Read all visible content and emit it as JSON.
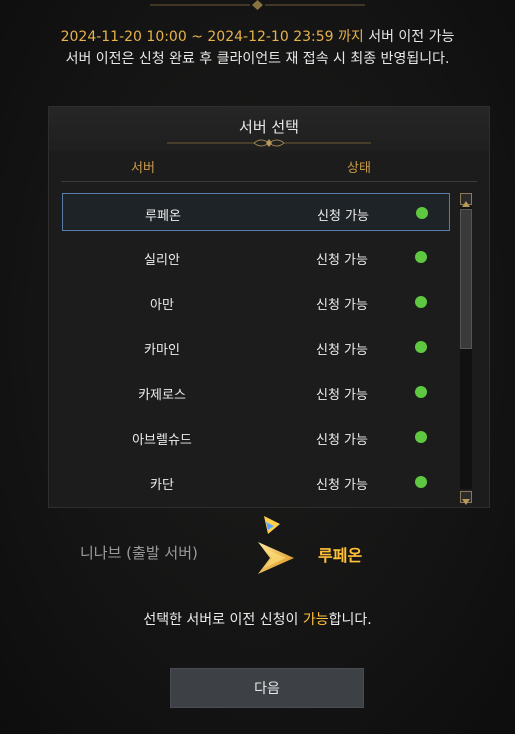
{
  "notice": {
    "period": "2024-11-20 10:00 ~ 2024-12-10 23:59 까지",
    "period_suffix": " 서버 이전 가능",
    "line2": "서버 이전은 신청 완료 후 클라이언트 재 접속 시 최종 반영됩니다."
  },
  "panel": {
    "title": "서버 선택",
    "col_server": "서버",
    "col_status": "상태",
    "rows": [
      {
        "name": "루페온",
        "status": "신청 가능",
        "selected": true
      },
      {
        "name": "실리안",
        "status": "신청 가능"
      },
      {
        "name": "아만",
        "status": "신청 가능"
      },
      {
        "name": "카마인",
        "status": "신청 가능"
      },
      {
        "name": "카제로스",
        "status": "신청 가능"
      },
      {
        "name": "아브렐슈드",
        "status": "신청 가능"
      },
      {
        "name": "카단",
        "status": "신청 가능"
      }
    ]
  },
  "transfer": {
    "from": "니나브 (출발 서버)",
    "to": "루페온"
  },
  "result": {
    "prefix": "선택한 서버로 이전 신청이 ",
    "highlight": "가능",
    "suffix": "합니다."
  },
  "next_button": "다음",
  "colors": {
    "gold": "#e6b24a",
    "available_dot": "#5ec840",
    "selected_border": "#5a7ea6"
  }
}
